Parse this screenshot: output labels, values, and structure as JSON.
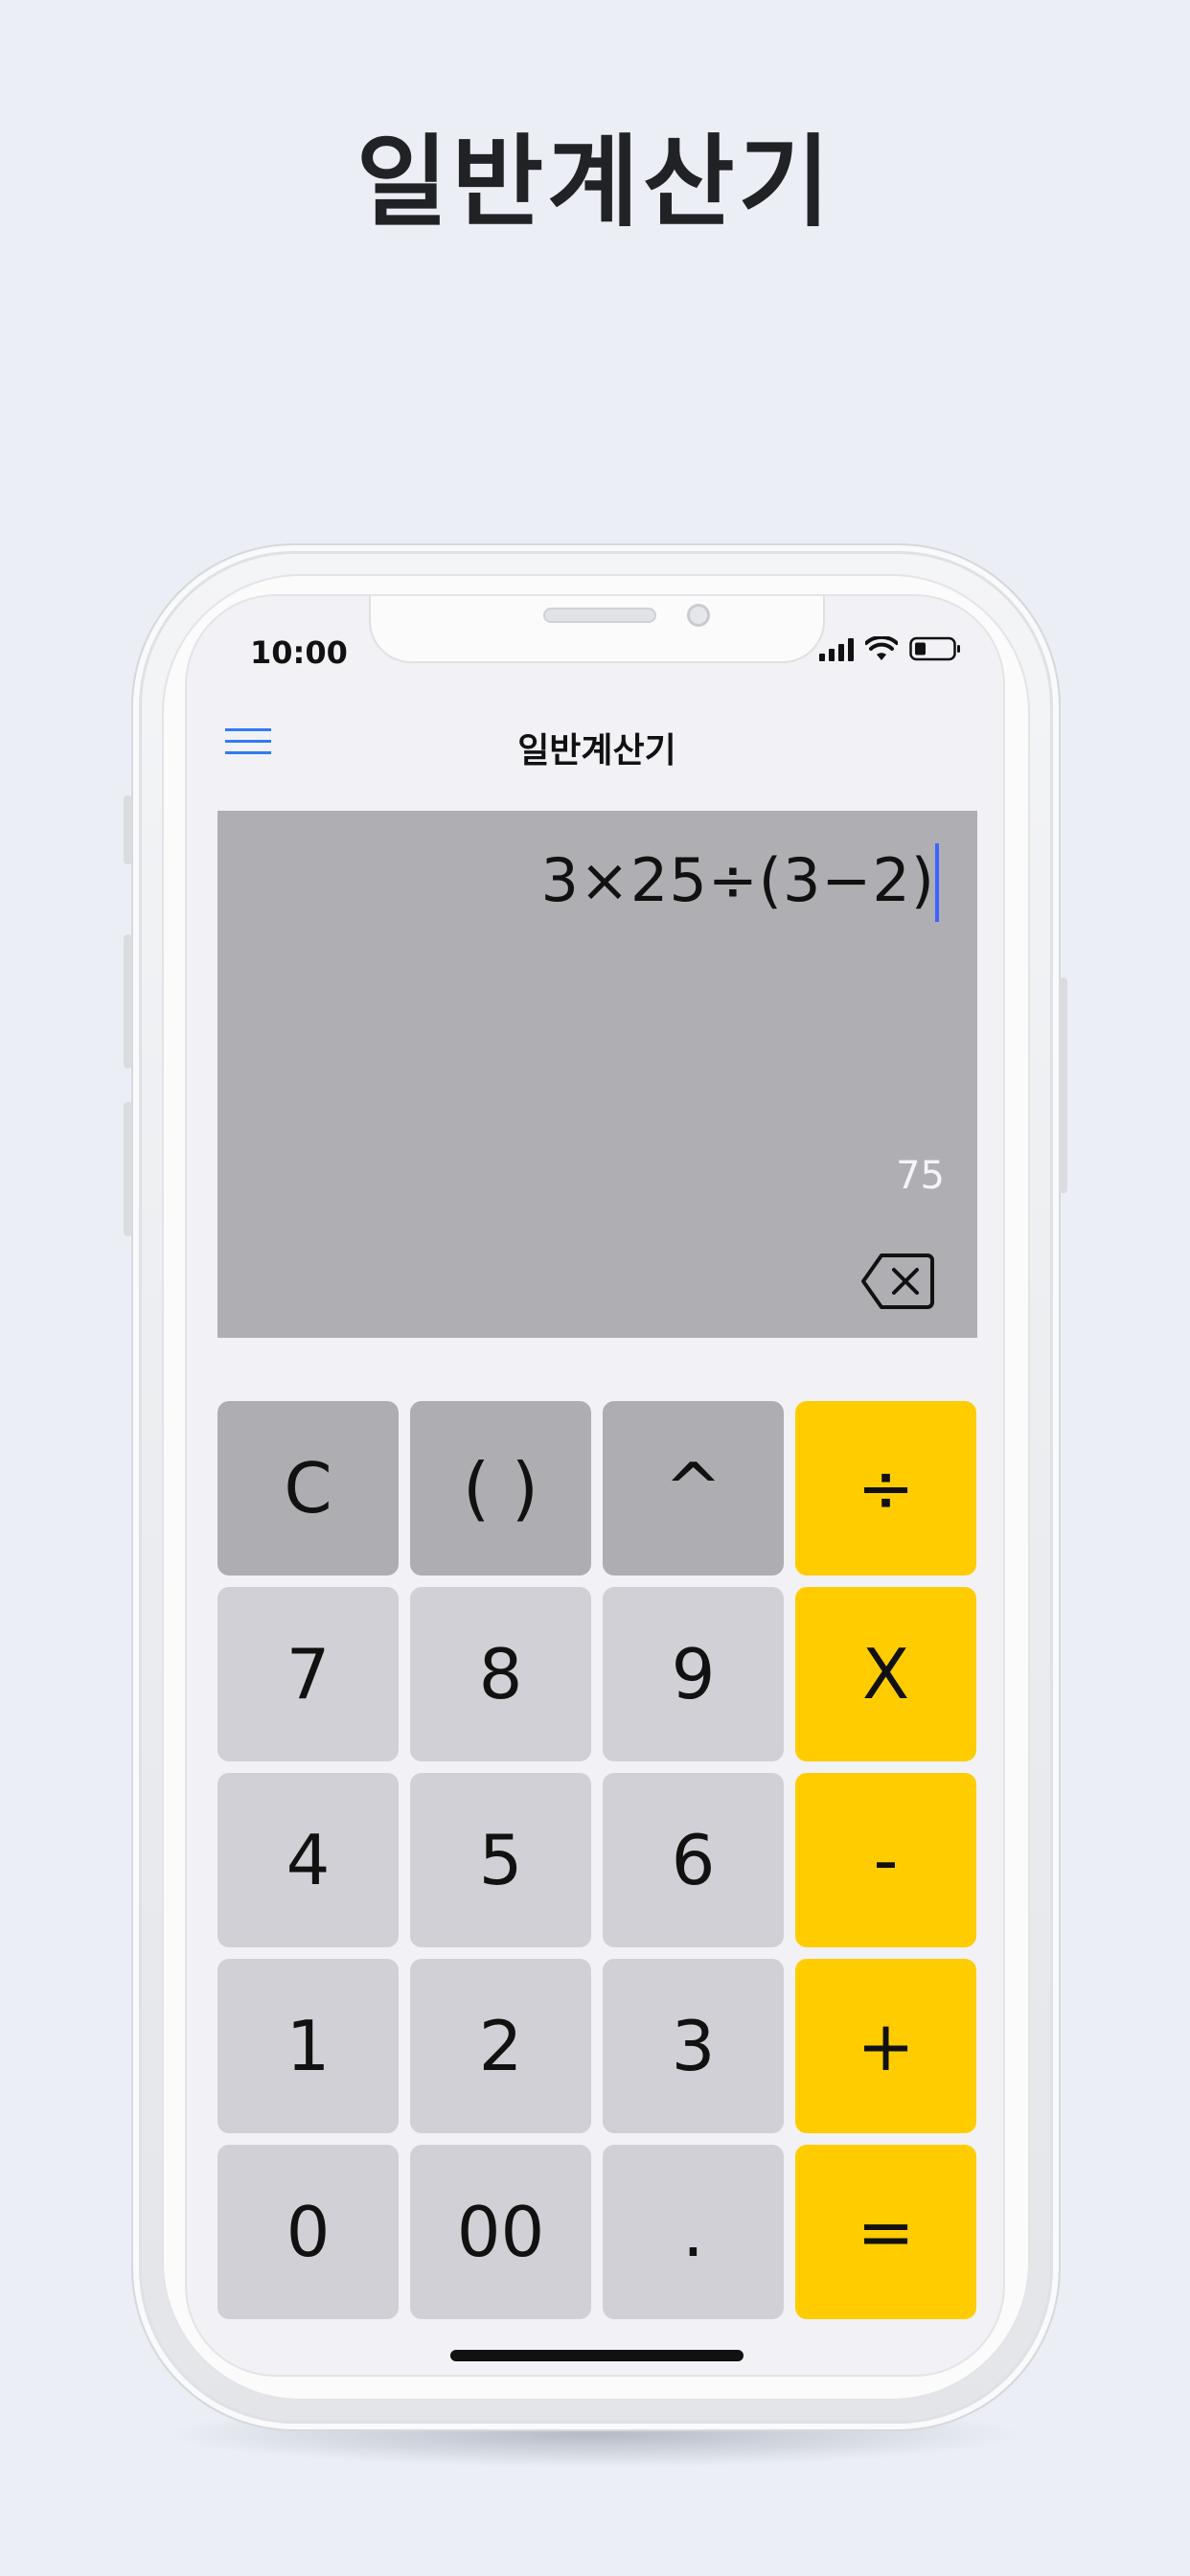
{
  "promo": {
    "title": "일반계산기"
  },
  "status_bar": {
    "time": "10:00"
  },
  "nav": {
    "title": "일반계산기"
  },
  "display": {
    "expression": "3×25÷(3−2)",
    "result": "75"
  },
  "keys": [
    {
      "label": "C",
      "kind": "func",
      "name": "clear-key"
    },
    {
      "label": "( )",
      "kind": "func",
      "name": "parentheses-key"
    },
    {
      "label": "^",
      "kind": "func",
      "name": "power-key"
    },
    {
      "label": "÷",
      "kind": "op",
      "name": "divide-key"
    },
    {
      "label": "7",
      "kind": "num",
      "name": "digit-7-key"
    },
    {
      "label": "8",
      "kind": "num",
      "name": "digit-8-key"
    },
    {
      "label": "9",
      "kind": "num",
      "name": "digit-9-key"
    },
    {
      "label": "X",
      "kind": "op",
      "name": "multiply-key"
    },
    {
      "label": "4",
      "kind": "num",
      "name": "digit-4-key"
    },
    {
      "label": "5",
      "kind": "num",
      "name": "digit-5-key"
    },
    {
      "label": "6",
      "kind": "num",
      "name": "digit-6-key"
    },
    {
      "label": "-",
      "kind": "op",
      "name": "subtract-key"
    },
    {
      "label": "1",
      "kind": "num",
      "name": "digit-1-key"
    },
    {
      "label": "2",
      "kind": "num",
      "name": "digit-2-key"
    },
    {
      "label": "3",
      "kind": "num",
      "name": "digit-3-key"
    },
    {
      "label": "+",
      "kind": "op",
      "name": "add-key"
    },
    {
      "label": "0",
      "kind": "num",
      "name": "digit-0-key"
    },
    {
      "label": "00",
      "kind": "num",
      "name": "double-zero-key"
    },
    {
      "label": ".",
      "kind": "num",
      "name": "decimal-point-key"
    },
    {
      "label": "=",
      "kind": "op",
      "name": "equals-key"
    }
  ],
  "colors": {
    "accent_operator": "#ffcc00",
    "function_key": "#aeadb2",
    "number_key": "#d1d0d6",
    "display_background": "#afaeb3",
    "menu_icon": "#2f7cf6",
    "caret": "#3e64ff"
  },
  "icons": {
    "menu": "hamburger-menu-icon",
    "backspace": "backspace-icon",
    "signal": "cellular-signal-icon",
    "wifi": "wifi-icon",
    "battery": "battery-icon"
  }
}
